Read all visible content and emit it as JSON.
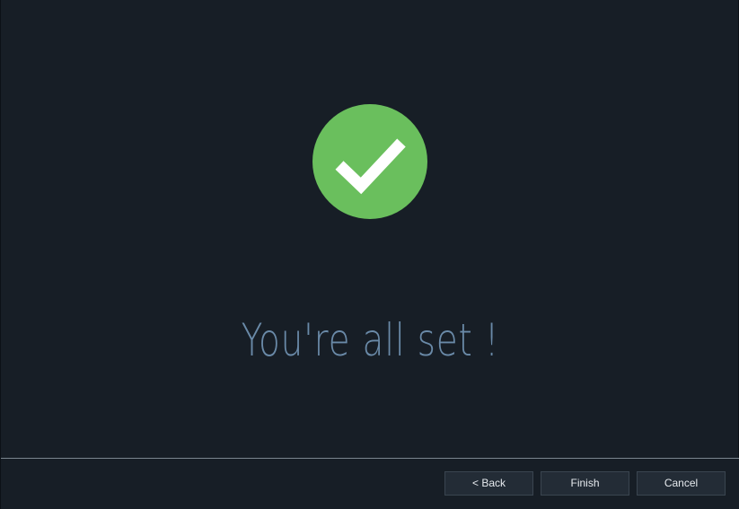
{
  "main": {
    "icon": "check-circle-icon",
    "icon_color": "#6abf5d",
    "headline": "You're all set !",
    "headline_color": "#6a8aa8"
  },
  "footer": {
    "back_label": "< Back",
    "finish_label": "Finish",
    "cancel_label": "Cancel"
  },
  "theme": {
    "background": "#171e26",
    "button_background": "#232c36",
    "button_text": "#e6eaee"
  }
}
